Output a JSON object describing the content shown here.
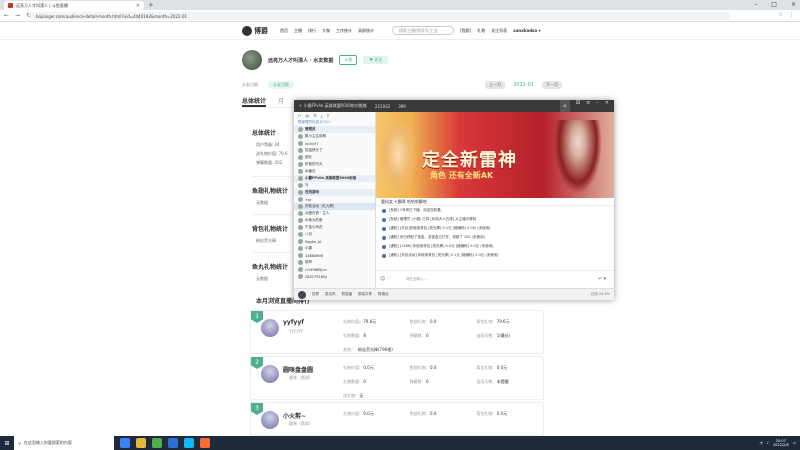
{
  "browser": {
    "tab_title": "远亮万人才叫漂人 | 斗鱼直播",
    "url": "bojianger.com/audience-detail-month.html?uid=4440192&month=2022-01"
  },
  "site": {
    "logo": "博爵",
    "menu": [
      "首页",
      "主播",
      "排行",
      "大咖",
      "工作统计",
      "录屏统计"
    ],
    "search_placeholder": "搜索主播/房间号/工会",
    "right_links": [
      "[我都]",
      "礼物",
      "关注列表"
    ],
    "user": "xanxkadsa ▾"
  },
  "profile": {
    "name": "远亮万人才叫漂人 · 水友数据",
    "btn1": "斗鱼",
    "btn2": "♥ 关注",
    "sub_label": "水友日报",
    "sub_pill": "水友月报",
    "nav_prev": "上一月",
    "month": "2022-01",
    "nav_next": "下一月"
  },
  "tabs": {
    "active": "总体统计",
    "inactive": "月"
  },
  "sections": {
    "s1": "总体统计",
    "s1_lines": [
      "用户等级: 24",
      "送礼物价值: 79.6",
      "弹幕数量: 202"
    ],
    "s2": "鱼翅礼物统计",
    "s2_line": "无数据",
    "s3": "背包礼物统计",
    "s3_line": "粉丝荧光棒",
    "s4": "鱼丸礼物统计",
    "s4_line": "无数据",
    "rank": "本月浏览直播间排行"
  },
  "cards": [
    {
      "rank": "1",
      "name": "yyfyyf",
      "sub": "YYFYYF",
      "cols": [
        [
          "礼物价值:",
          "79.6元"
        ],
        [
          "鱼翅礼物:",
          "0.0"
        ],
        [
          "背包礼物:",
          "79.6元"
        ],
        [
          "礼物数量:",
          "8"
        ],
        [
          "弹幕数:",
          "0"
        ],
        [
          "连续天数:",
          "1(最长)"
        ],
        [
          "其他：",
          "粉丝荧光棒(796根)"
        ]
      ]
    },
    {
      "rank": "2",
      "name": "圆咪盘盘圆",
      "sub": "圆咪（翡翠）",
      "cols": [
        [
          "礼物价值:",
          "0.0元"
        ],
        [
          "鱼翅礼物:",
          "0.0"
        ],
        [
          "背包礼物:",
          "0.0元"
        ],
        [
          "礼物数量:",
          "0"
        ],
        [
          "弹幕数:",
          "0"
        ],
        [
          "连续天数:",
          "未提醒"
        ],
        [
          "送礼物:",
          "无"
        ]
      ]
    },
    {
      "rank": "3",
      "name": "小火剪~",
      "sub": "圆咪（翡翠）",
      "cols": [
        [
          "礼物价值:",
          "0.0元"
        ],
        [
          "鱼翅礼物:",
          "0.0"
        ],
        [
          "背包礼物:",
          "0.0元"
        ],
        [
          "礼物数量:",
          "0"
        ],
        [
          "弹幕数:",
          "0"
        ],
        [
          "连续天数:",
          "未提醒"
        ],
        [
          "送礼物:",
          "无"
        ]
      ]
    }
  ],
  "qq": {
    "title": "+ 小霸FPvlin 英雄联盟5000射对推推",
    "members_count": "221932",
    "online": "399",
    "tools": [
      "↩",
      "▤",
      "☰",
      "⤓",
      "⚲"
    ],
    "info": "群管理员在线 87/11",
    "members": [
      {
        "name": "管理员",
        "kind": "chan"
      },
      {
        "name": "群小主往前萌",
        "kind": "m"
      },
      {
        "name": "lucky97",
        "kind": "m"
      },
      {
        "name": "狂滥狭长了",
        "kind": "m"
      },
      {
        "name": "团长",
        "kind": "m"
      },
      {
        "name": "挤饭的可大",
        "kind": "m"
      },
      {
        "name": "水番石",
        "kind": "m"
      },
      {
        "name": "小霸FPvlin 英雄联盟5000射推",
        "kind": "chan"
      },
      {
        "name": "冷",
        "kind": "m"
      },
      {
        "name": "在线游戏",
        "kind": "chan"
      },
      {
        "name": "+ar",
        "kind": "m"
      },
      {
        "name": "开放活动（红九歌）",
        "kind": "sel"
      },
      {
        "name": "兵狸在鲁 · 主人",
        "kind": "m"
      },
      {
        "name": "水鱼大的鱼",
        "kind": "m"
      },
      {
        "name": "千金公司花",
        "kind": "m"
      },
      {
        "name": "八月",
        "kind": "m"
      },
      {
        "name": "flagfor_bl",
        "kind": "m"
      },
      {
        "name": "小霸",
        "kind": "m"
      },
      {
        "name": "14880898",
        "kind": "m"
      },
      {
        "name": "锦爷",
        "kind": "m"
      },
      {
        "name": "Li199865Jun",
        "kind": "m"
      },
      {
        "name": "28427918Sy",
        "kind": "m"
      }
    ],
    "banner_big": "定全新雷神",
    "banner_sm": "角色  还有全新AK",
    "chat_top": "鹿仙女 <霸得 哈哈哈解哈",
    "messages": [
      "[系统] 1号房已下播，欢迎您收看。",
      "[系统] 管理员 (小霸) 已将 [彩网大人石排] 从主播中移除",
      "[通知] [开启]你使用背包 [荧光棒] 0.1元 [摊赚粉] 0.0元 (未使用)",
      "[通知] 你已获取了宝盒，该宝盒已打开，领取了 200 (未使用)",
      "[通知] [1488] 你使用背包 [荧光棒] 0.0元 [摊赚粉] 0.0元 (未使用)",
      "[通知] [开启活动] 你使用背包 [荧光棒] 0.1元 [摊赚粉] 0.0元 (未使用)"
    ],
    "input_placeholder": "请在此输入...",
    "bottom_items": [
      "投票",
      "麦克风",
      "群直播",
      "屏幕共享",
      "群通话"
    ],
    "bottom_right": "已用 24.9%"
  },
  "taskbar": {
    "search": "在这里输入你要搜索的内容",
    "time": "20:07",
    "date": "2022/2/8"
  }
}
